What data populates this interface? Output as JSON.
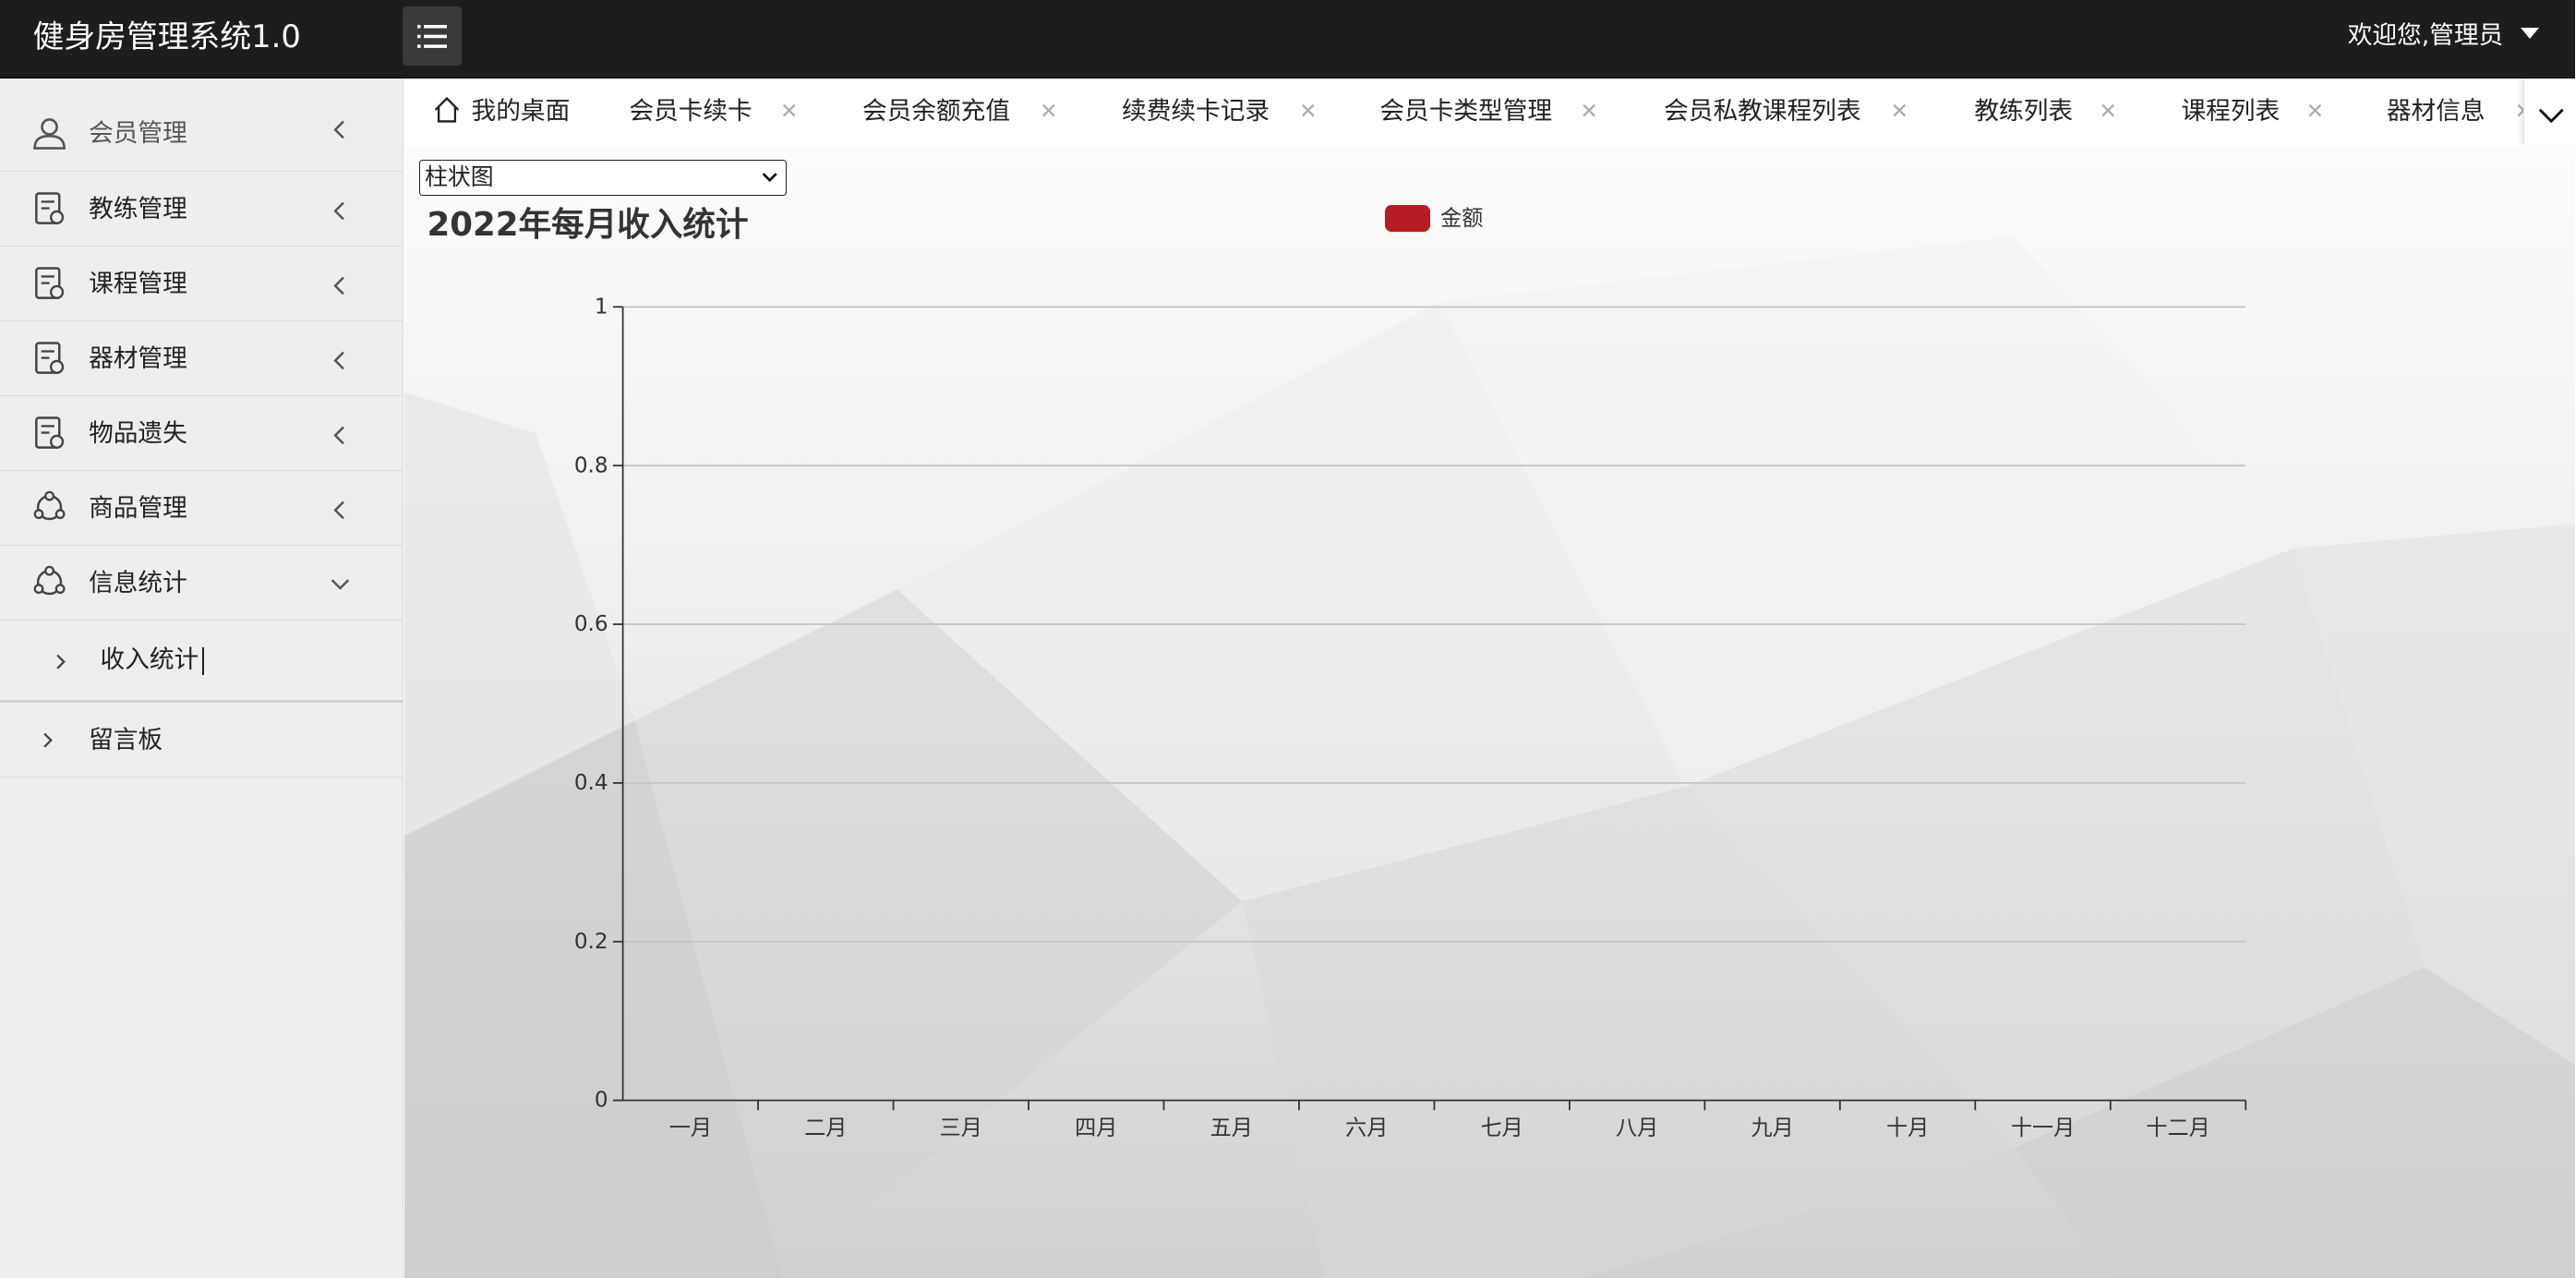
{
  "app": {
    "title": "健身房管理系统1.0",
    "welcome": "欢迎您,管理员"
  },
  "sidebar": {
    "items": [
      {
        "label": "会员管理",
        "icon": "user-icon",
        "expanded": false
      },
      {
        "label": "教练管理",
        "icon": "document-icon",
        "expanded": false
      },
      {
        "label": "课程管理",
        "icon": "document-icon",
        "expanded": false
      },
      {
        "label": "器材管理",
        "icon": "document-icon",
        "expanded": false
      },
      {
        "label": "物品遗失",
        "icon": "document-icon",
        "expanded": false
      },
      {
        "label": "商品管理",
        "icon": "share-icon",
        "expanded": false
      },
      {
        "label": "信息统计",
        "icon": "share-icon",
        "expanded": true
      }
    ],
    "sub_items": [
      {
        "label": "收入统计"
      }
    ],
    "extra_items": [
      {
        "label": "留言板"
      }
    ]
  },
  "tabs": [
    {
      "label": "我的桌面",
      "closable": false
    },
    {
      "label": "会员卡续卡",
      "closable": true
    },
    {
      "label": "会员余额充值",
      "closable": true
    },
    {
      "label": "续费续卡记录",
      "closable": true
    },
    {
      "label": "会员卡类型管理",
      "closable": true
    },
    {
      "label": "会员私教课程列表",
      "closable": true
    },
    {
      "label": "教练列表",
      "closable": true
    },
    {
      "label": "课程列表",
      "closable": true
    },
    {
      "label": "器材信息",
      "closable": true
    }
  ],
  "chart_select": {
    "value": "柱状图"
  },
  "colors": {
    "series": "#b71c25"
  },
  "chart_data": {
    "type": "bar",
    "title": "2022年每月收入统计",
    "categories": [
      "一月",
      "二月",
      "三月",
      "四月",
      "五月",
      "六月",
      "七月",
      "八月",
      "九月",
      "十月",
      "十一月",
      "十二月"
    ],
    "series": [
      {
        "name": "金额",
        "values": [
          0,
          0,
          0,
          0,
          0,
          0,
          0,
          0,
          0,
          0,
          0,
          0
        ]
      }
    ],
    "ylim": [
      0,
      1
    ],
    "yticks": [
      "0",
      "0.2",
      "0.4",
      "0.6",
      "0.8",
      "1"
    ],
    "grid": true,
    "legend_position": "top-center"
  }
}
